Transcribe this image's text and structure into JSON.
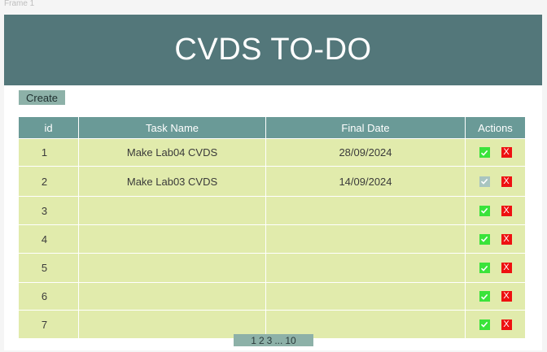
{
  "frame": {
    "label": "Frame 1"
  },
  "header": {
    "title": "CVDS TO-DO"
  },
  "toolbar": {
    "create_label": "Create"
  },
  "table": {
    "columns": [
      "id",
      "Task Name",
      "Final Date",
      "Actions"
    ],
    "rows": [
      {
        "id": "1",
        "task": "Make Lab04 CVDS",
        "date": "28/09/2024",
        "done": false
      },
      {
        "id": "2",
        "task": "Make Lab03 CVDS",
        "date": "14/09/2024",
        "done": true
      },
      {
        "id": "3",
        "task": "",
        "date": "",
        "done": false
      },
      {
        "id": "4",
        "task": "",
        "date": "",
        "done": false
      },
      {
        "id": "5",
        "task": "",
        "date": "",
        "done": false
      },
      {
        "id": "6",
        "task": "",
        "date": "",
        "done": false
      },
      {
        "id": "7",
        "task": "",
        "date": "",
        "done": false
      }
    ],
    "delete_label": "X"
  },
  "pagination": {
    "pages": [
      "1",
      "2",
      "3"
    ],
    "ellipsis": "...",
    "last": "10"
  },
  "colors": {
    "header_bg": "#53777a",
    "table_header_bg": "#6a9a97",
    "row_bg": "#e1ebac",
    "check": "#3ae33a",
    "check_disabled": "#a9c5c0",
    "delete": "#ee1111",
    "button_bg": "#8db1a8"
  },
  "icons": {
    "complete": "check-icon",
    "delete": "close-icon"
  }
}
